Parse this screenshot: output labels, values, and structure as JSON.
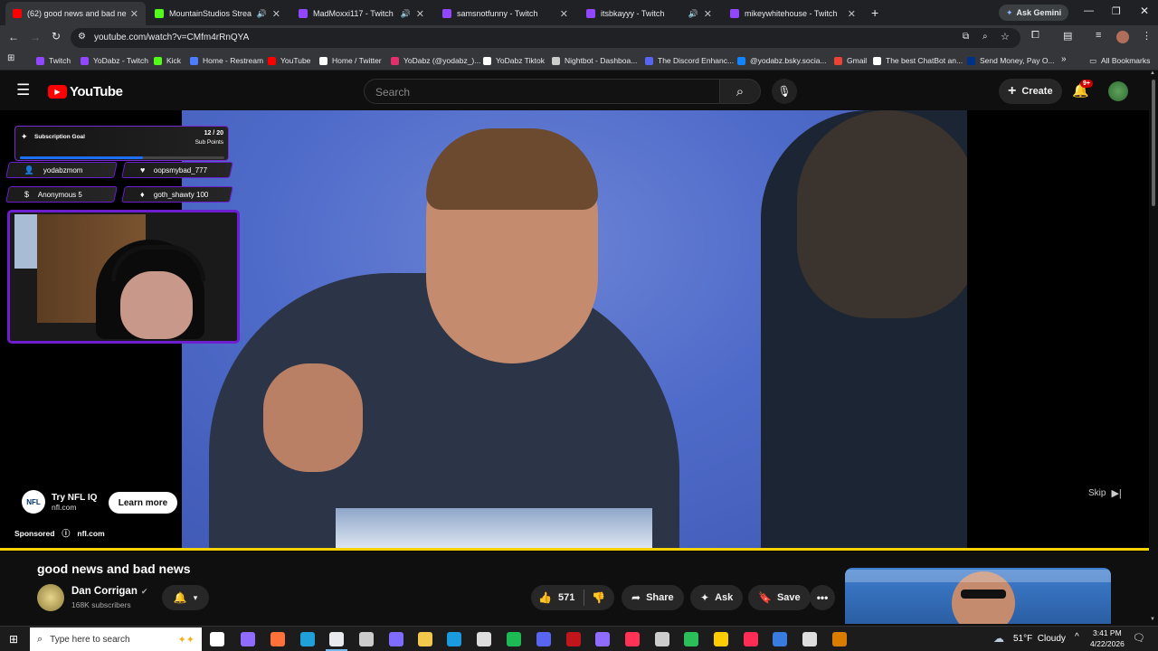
{
  "tabs": [
    {
      "title": "(62) good news and bad ne",
      "favicon_color": "#ff0000",
      "active": true,
      "audio": false
    },
    {
      "title": "MountainStudios Stream -",
      "favicon_color": "#53fc18",
      "active": false,
      "audio": true
    },
    {
      "title": "MadMoxxi117 - Twitch",
      "favicon_color": "#9146ff",
      "active": false,
      "audio": true
    },
    {
      "title": "samsnotfunny - Twitch",
      "favicon_color": "#9146ff",
      "active": false,
      "audio": false
    },
    {
      "title": "itsbkayyy - Twitch",
      "favicon_color": "#9146ff",
      "active": false,
      "audio": true
    },
    {
      "title": "mikeywhitehouse - Twitch",
      "favicon_color": "#9146ff",
      "active": false,
      "audio": false
    }
  ],
  "ask_gemini": "Ask Gemini",
  "url": "youtube.com/watch?v=CMfm4rRnQYA",
  "bookmarks": [
    {
      "label": "Twitch",
      "color": "#9146ff"
    },
    {
      "label": "YoDabz - Twitch",
      "color": "#9146ff"
    },
    {
      "label": "Kick",
      "color": "#53fc18"
    },
    {
      "label": "Home - Restream",
      "color": "#4d7cfe"
    },
    {
      "label": "YouTube",
      "color": "#ff0000"
    },
    {
      "label": "Home / Twitter",
      "color": "#ffffff"
    },
    {
      "label": "YoDabz (@yodabz_)...",
      "color": "#e1306c"
    },
    {
      "label": "YoDabz Tiktok",
      "color": "#ffffff"
    },
    {
      "label": "Nightbot - Dashboa...",
      "color": "#cccccc"
    },
    {
      "label": "The Discord Enhanc...",
      "color": "#5865f2"
    },
    {
      "label": "@yodabz.bsky.socia...",
      "color": "#1185fe"
    },
    {
      "label": "Gmail",
      "color": "#ea4335"
    },
    {
      "label": "The best ChatBot an...",
      "color": "#ffffff"
    },
    {
      "label": "Send Money, Pay O...",
      "color": "#003087"
    }
  ],
  "all_bookmarks": "All Bookmarks",
  "yt": {
    "logo_text": "YouTube",
    "search_placeholder": "Search",
    "create_label": "Create",
    "notif_badge": "9+"
  },
  "overlay": {
    "goal_title": "Subscription Goal",
    "goal_count": "12 / 20",
    "goal_unit": "Sub Points",
    "goal_progress": 0.6,
    "alerts": [
      {
        "name": "yodabzmom",
        "icon": "person-icon"
      },
      {
        "name": "oopsmybad_777",
        "icon": "heart-icon"
      },
      {
        "name": "Anonymous 5",
        "icon": "dollar-icon"
      },
      {
        "name": "goth_shawty 100",
        "icon": "gem-icon"
      }
    ]
  },
  "ad": {
    "title": "Try NFL IQ",
    "domain": "nfl.com",
    "cta": "Learn more",
    "sponsored": "Sponsored",
    "sponsored_domain": "nfl.com",
    "skip": "Skip"
  },
  "video": {
    "title": "good news and bad news",
    "channel": "Dan Corrigan",
    "subscribers": "168K subscribers",
    "likes": "571",
    "share": "Share",
    "ask": "Ask",
    "save": "Save"
  },
  "taskbar": {
    "search_placeholder": "Type here to search",
    "weather": "51°F  Cloudy",
    "time": "3:41 PM",
    "date": "4/22/2026"
  }
}
